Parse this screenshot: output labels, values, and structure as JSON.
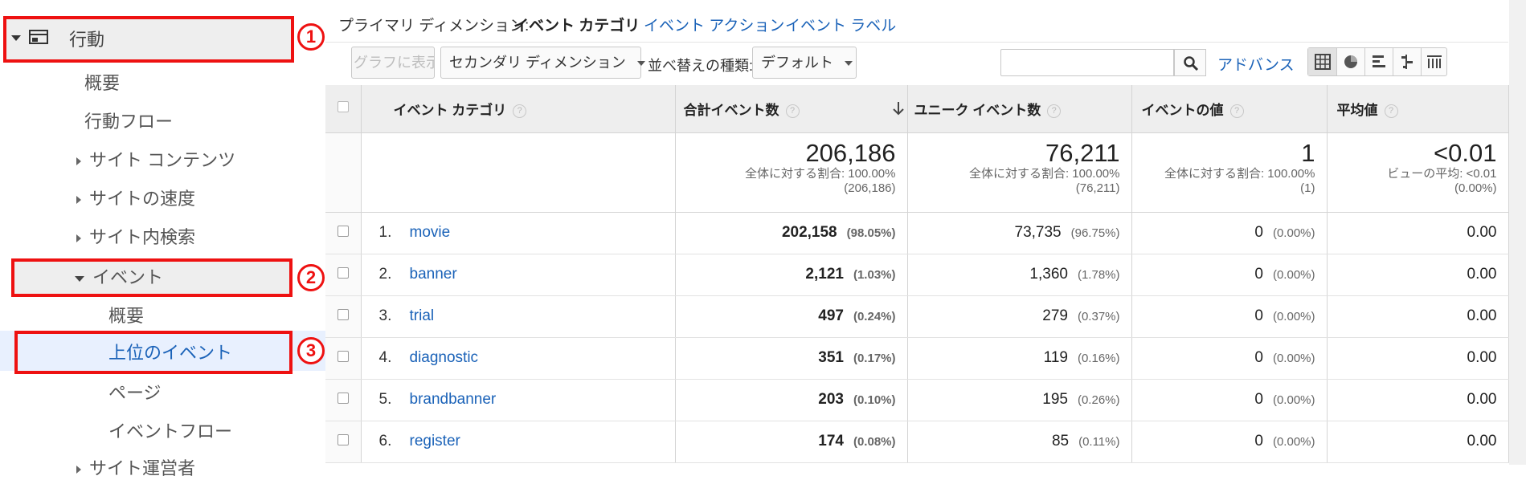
{
  "sidebar": {
    "behavior_label": "行動",
    "items": {
      "overview": "概要",
      "behavior_flow": "行動フロー",
      "site_content": "サイト コンテンツ",
      "site_speed": "サイトの速度",
      "site_search": "サイト内検索",
      "events": "イベント",
      "events_overview": "概要",
      "top_events": "上位のイベント",
      "pages": "ページ",
      "events_flow": "イベントフロー",
      "publisher": "サイト運営者"
    },
    "annotations": [
      "1",
      "2",
      "3"
    ]
  },
  "primary_dimension": {
    "label": "プライマリ ディメンション:",
    "current": "イベント カテゴリ",
    "options": [
      "イベント アクション",
      "イベント ラベル"
    ]
  },
  "toolbar": {
    "graph_button": "グラフに表示",
    "secondary_dimension": "セカンダリ ディメンション",
    "sort_label": "並べ替えの種類:",
    "sort_value": "デフォルト",
    "search_placeholder": "",
    "advanced": "アドバンス",
    "view_icons": [
      "table-view-icon",
      "pie-view-icon",
      "performance-view-icon",
      "comparison-view-icon",
      "pivot-view-icon"
    ]
  },
  "table": {
    "headers": {
      "category": "イベント カテゴリ",
      "total_events": "合計イベント数",
      "unique_events": "ユニーク イベント数",
      "event_value": "イベントの値",
      "avg_value": "平均値"
    },
    "totals": {
      "total_events": "206,186",
      "total_events_sub1": "全体に対する割合: 100.00%",
      "total_events_sub2": "(206,186)",
      "unique_events": "76,211",
      "unique_events_sub1": "全体に対する割合: 100.00%",
      "unique_events_sub2": "(76,211)",
      "event_value": "1",
      "event_value_sub1": "全体に対する割合: 100.00%",
      "event_value_sub2": "(1)",
      "avg_value": "<0.01",
      "avg_value_sub1": "ビューの平均: <0.01",
      "avg_value_sub2": "(0.00%)"
    },
    "rows": [
      {
        "rank": "1.",
        "category": "movie",
        "total": "202,158",
        "total_pct": "(98.05%)",
        "unique": "73,735",
        "unique_pct": "(96.75%)",
        "value": "0",
        "value_pct": "(0.00%)",
        "avg": "0.00"
      },
      {
        "rank": "2.",
        "category": "banner",
        "total": "2,121",
        "total_pct": "(1.03%)",
        "unique": "1,360",
        "unique_pct": "(1.78%)",
        "value": "0",
        "value_pct": "(0.00%)",
        "avg": "0.00"
      },
      {
        "rank": "3.",
        "category": "trial",
        "total": "497",
        "total_pct": "(0.24%)",
        "unique": "279",
        "unique_pct": "(0.37%)",
        "value": "0",
        "value_pct": "(0.00%)",
        "avg": "0.00"
      },
      {
        "rank": "4.",
        "category": "diagnostic",
        "total": "351",
        "total_pct": "(0.17%)",
        "unique": "119",
        "unique_pct": "(0.16%)",
        "value": "0",
        "value_pct": "(0.00%)",
        "avg": "0.00"
      },
      {
        "rank": "5.",
        "category": "brandbanner",
        "total": "203",
        "total_pct": "(0.10%)",
        "unique": "195",
        "unique_pct": "(0.26%)",
        "value": "0",
        "value_pct": "(0.00%)",
        "avg": "0.00"
      },
      {
        "rank": "6.",
        "category": "register",
        "total": "174",
        "total_pct": "(0.08%)",
        "unique": "85",
        "unique_pct": "(0.11%)",
        "value": "0",
        "value_pct": "(0.00%)",
        "avg": "0.00"
      }
    ]
  },
  "colors": {
    "annotation_red": "#ee1111",
    "link_blue": "#1a62b8",
    "selected_bg": "#e8f0fe"
  }
}
